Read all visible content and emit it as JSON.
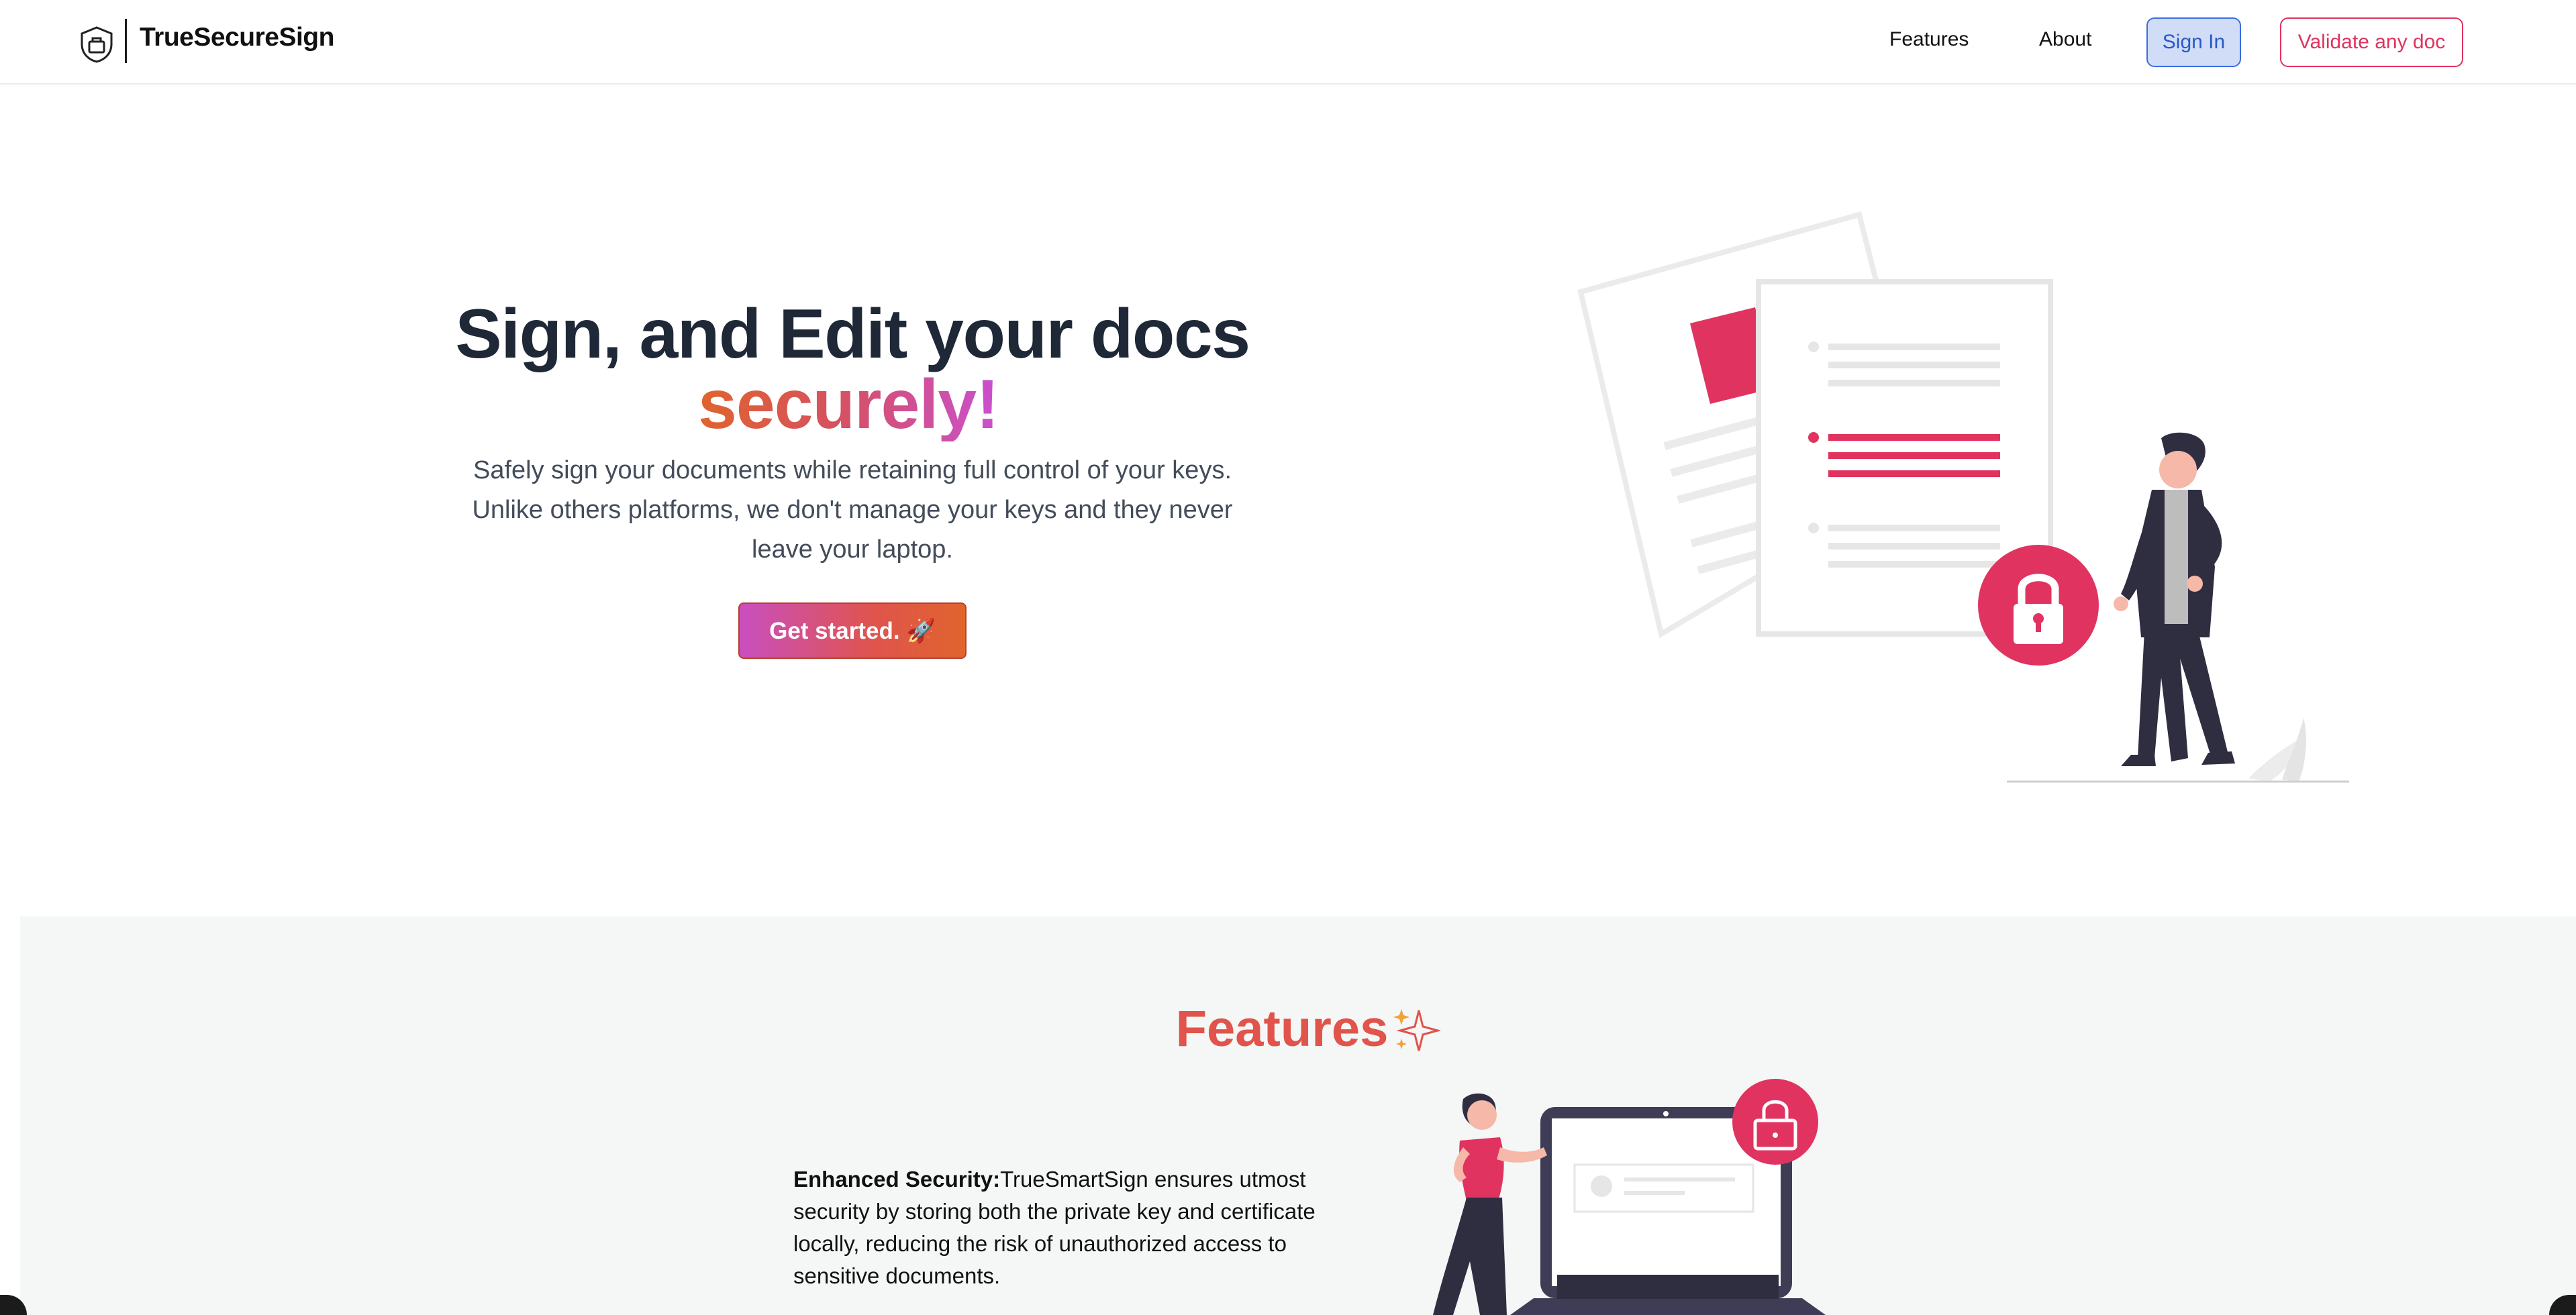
{
  "navbar": {
    "brand": "TrueSecureSign",
    "links": {
      "features": "Features",
      "about": "About"
    },
    "sign_in": "Sign In",
    "validate": "Validate any doc"
  },
  "hero": {
    "title": "Sign, and Edit your docs",
    "title_accent": "securely!",
    "subtitle": "Safely sign your documents while retaining full control of your keys. Unlike others platforms, we don't manage your keys and they never leave your laptop.",
    "cta": "Get started. 🚀"
  },
  "features": {
    "heading": "Features",
    "items": [
      {
        "title": "Enhanced Security:",
        "text": "TrueSmartSign ensures utmost security by storing both the private key and certificate locally, reducing the risk of unauthorized access to sensitive documents."
      }
    ]
  },
  "colors": {
    "accent_pink": "#e0335f",
    "accent_orange": "#e0642d",
    "accent_purple": "#c94fd6",
    "sign_in_blue": "#3c6de0",
    "features_bg": "#f4f7f6"
  },
  "icons": [
    "shield-bag-icon",
    "lock-icon",
    "sparkle-icon",
    "rocket-icon"
  ]
}
